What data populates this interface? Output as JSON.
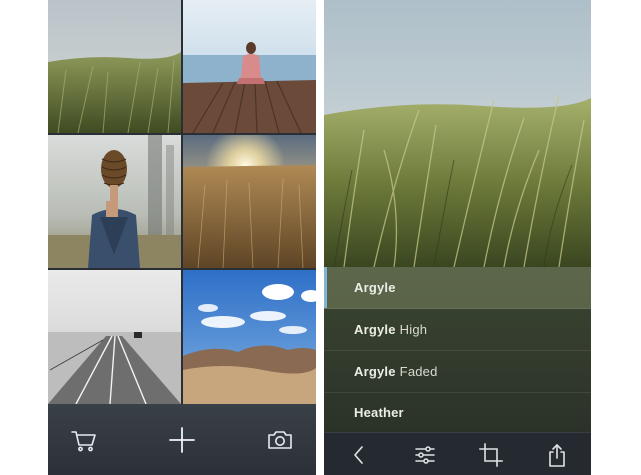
{
  "library": {
    "photos": [
      {
        "subject": "grass field"
      },
      {
        "subject": "woman on dock"
      },
      {
        "subject": "pinecone portrait"
      },
      {
        "subject": "sunset field"
      },
      {
        "subject": "snowy road"
      },
      {
        "subject": "desert sky"
      }
    ],
    "toolbar": {
      "cart_icon": "cart-icon",
      "add_icon": "plus-icon",
      "camera_icon": "camera-icon"
    }
  },
  "editor": {
    "filters": [
      {
        "name": "Argyle",
        "modifier": "",
        "selected": true
      },
      {
        "name": "Argyle",
        "modifier": "High",
        "selected": false
      },
      {
        "name": "Argyle",
        "modifier": "Faded",
        "selected": false
      },
      {
        "name": "Heather",
        "modifier": "",
        "selected": false
      }
    ],
    "toolbar": {
      "back_icon": "chevron-left-icon",
      "adjust_icon": "sliders-icon",
      "crop_icon": "crop-icon",
      "share_icon": "share-icon"
    },
    "accent_color": "#7fb6d6"
  }
}
